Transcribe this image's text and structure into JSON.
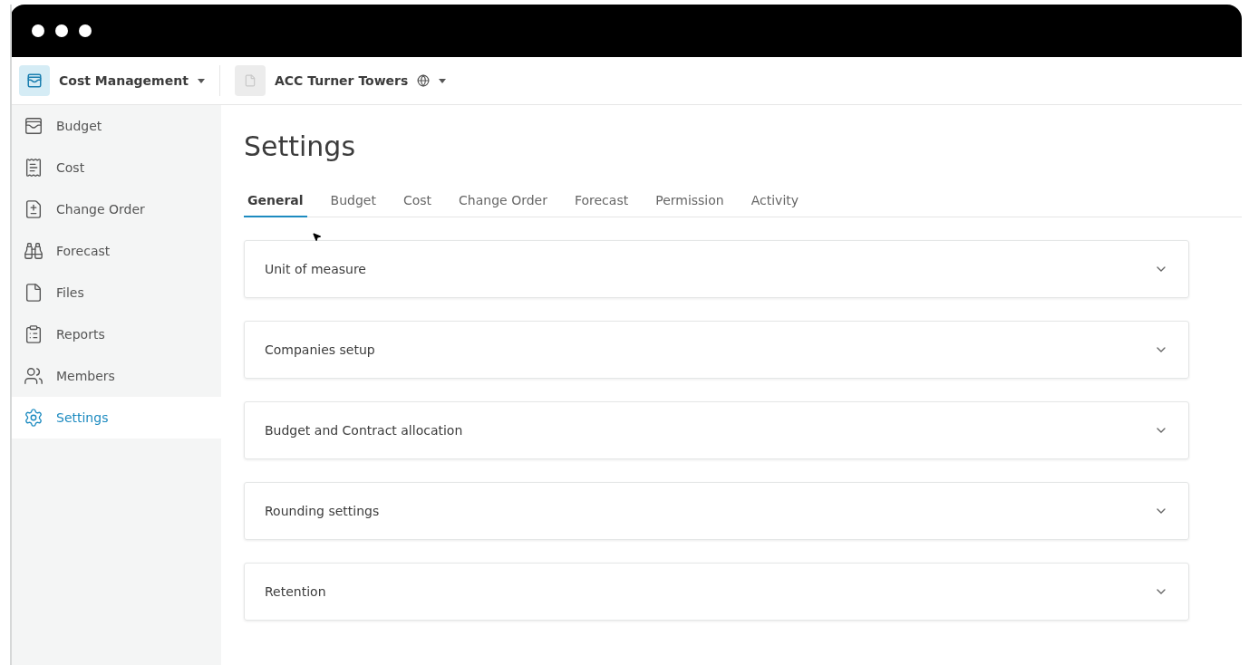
{
  "app_switcher": {
    "label": "Cost Management"
  },
  "project": {
    "label": "ACC Turner Towers"
  },
  "sidebar": {
    "items": [
      {
        "label": "Budget",
        "selected": false
      },
      {
        "label": "Cost",
        "selected": false
      },
      {
        "label": "Change Order",
        "selected": false
      },
      {
        "label": "Forecast",
        "selected": false
      },
      {
        "label": "Files",
        "selected": false
      },
      {
        "label": "Reports",
        "selected": false
      },
      {
        "label": "Members",
        "selected": false
      },
      {
        "label": "Settings",
        "selected": true
      }
    ]
  },
  "page": {
    "title": "Settings"
  },
  "tabs": [
    {
      "label": "General",
      "selected": true
    },
    {
      "label": "Budget",
      "selected": false
    },
    {
      "label": "Cost",
      "selected": false
    },
    {
      "label": "Change Order",
      "selected": false
    },
    {
      "label": "Forecast",
      "selected": false
    },
    {
      "label": "Permission",
      "selected": false
    },
    {
      "label": "Activity",
      "selected": false
    }
  ],
  "sections": [
    {
      "title": "Unit of measure",
      "expanded": false
    },
    {
      "title": "Companies setup",
      "expanded": false
    },
    {
      "title": "Budget and Contract allocation",
      "expanded": false
    },
    {
      "title": "Rounding settings",
      "expanded": false
    },
    {
      "title": "Retention",
      "expanded": false
    }
  ]
}
